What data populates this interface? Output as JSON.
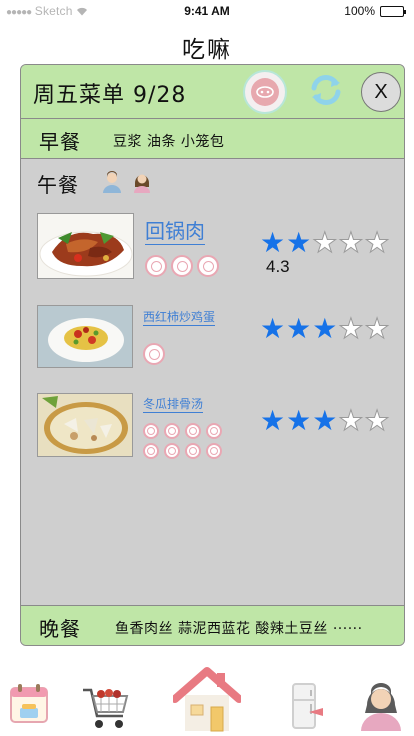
{
  "status_bar": {
    "carrier": "Sketch",
    "time": "9:41 AM",
    "battery": "100%",
    "battery_level": 1.0
  },
  "app": {
    "title": "吃嘛"
  },
  "menu": {
    "title": "周五菜单 9/28",
    "header_icons": [
      "pork-badge-icon",
      "refresh-icon"
    ],
    "close_label": "X",
    "breakfast": {
      "label": "早餐",
      "items": "豆浆 油条 小笼包"
    },
    "lunch": {
      "label": "午餐",
      "diner_icons": [
        "male-diner-icon",
        "female-diner-icon"
      ],
      "dishes": [
        {
          "name": "回锅肉",
          "rating_stars": 2,
          "rating_text": "4.3",
          "tags": 3
        },
        {
          "name": "西红柿炒鸡蛋",
          "rating_stars": 3,
          "tags": 1
        },
        {
          "name": "冬瓜排骨汤",
          "rating_stars": 3,
          "tags": 6
        }
      ]
    },
    "dinner": {
      "label": "晚餐",
      "items": "鱼香肉丝  蒜泥西蓝花  酸辣土豆丝 ······"
    }
  },
  "tabbar": {
    "items": [
      "calendar-icon",
      "shopping-cart-icon",
      "home-icon",
      "fridge-icon",
      "profile-icon"
    ],
    "colors": {
      "roof": "#e87a82",
      "house": "#f4eee4",
      "cart": "#c0392b"
    }
  },
  "colors": {
    "header_green": "#bfe6a7",
    "card_gray": "#cfcfcf",
    "star_blue": "#1672e8",
    "link_blue": "#3f7fd4"
  }
}
